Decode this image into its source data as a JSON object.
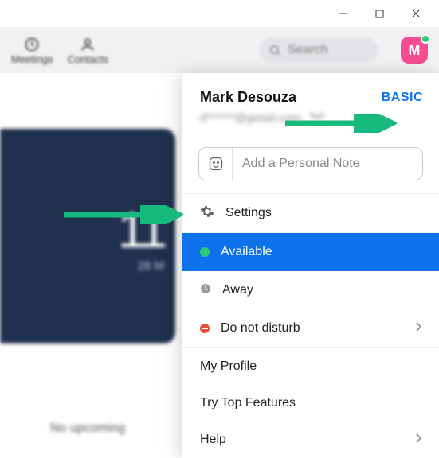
{
  "window": {
    "minimize": "–",
    "maximize": "□",
    "close": "×"
  },
  "top": {
    "meetings": "Meetings",
    "contacts": "Contacts",
    "search_placeholder": "Search",
    "avatar_letter": "M"
  },
  "card": {
    "time": "11",
    "date": "28 M"
  },
  "no_upcoming": "No upcoming",
  "dropdown": {
    "user_name": "Mark Desouza",
    "plan_badge": "BASIC",
    "email_masked": "d******@gmail.com",
    "note_placeholder": "Add a Personal Note",
    "settings": "Settings",
    "status_available": "Available",
    "status_away": "Away",
    "status_dnd": "Do not disturb",
    "my_profile": "My Profile",
    "try_top": "Try Top Features",
    "help": "Help"
  }
}
